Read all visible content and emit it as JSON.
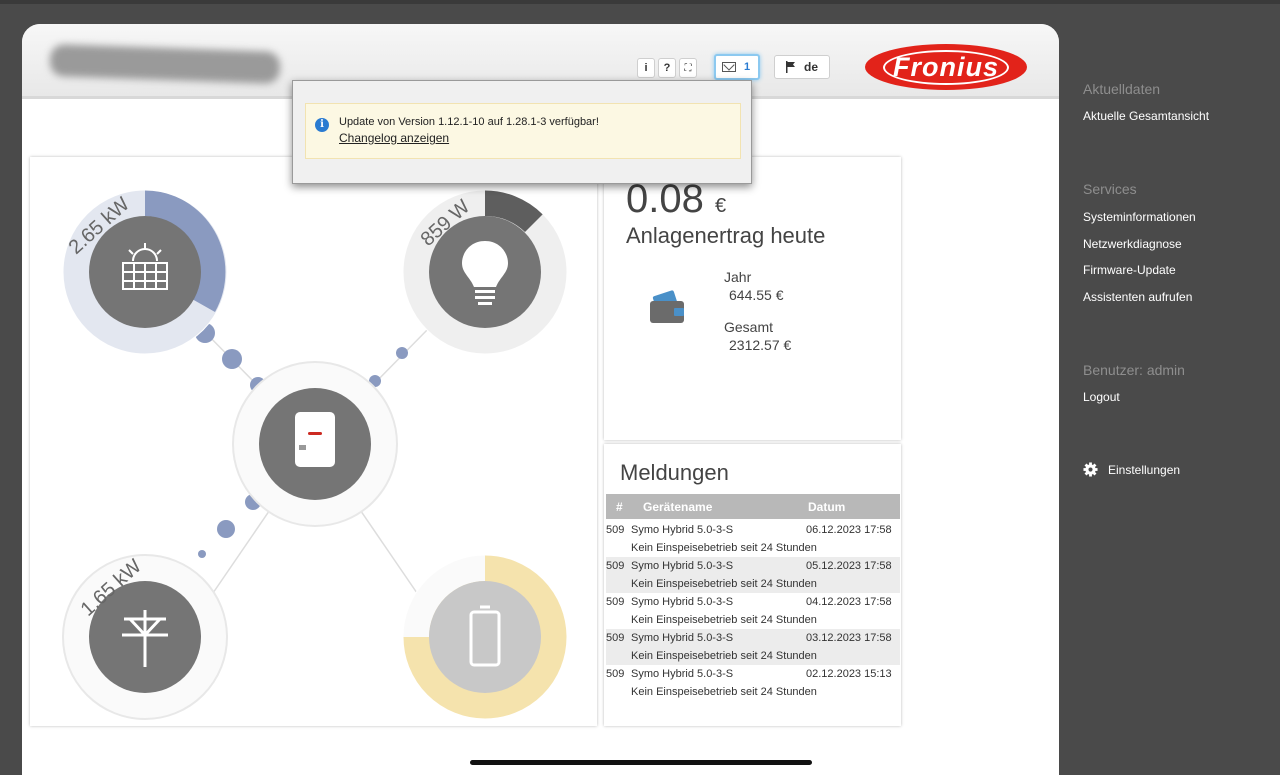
{
  "toolbar": {
    "info_label": "i",
    "help_label": "?",
    "fullscreen_label": "⛶",
    "mail_count": "1",
    "language": "de",
    "brand": "Fronius"
  },
  "popup": {
    "message": "Update von Version 1.12.1-10 auf 1.28.1-3 verfügbar!",
    "link": "Changelog anzeigen"
  },
  "flow": {
    "pv_power": "2.65 kW",
    "load_power": "859 W",
    "grid_power": "1.65 kW"
  },
  "earnings": {
    "today_value": "0.08",
    "currency": "€",
    "title": "Anlagenertrag heute",
    "year_label": "Jahr",
    "year_value": "644.55 €",
    "total_label": "Gesamt",
    "total_value": "2312.57 €"
  },
  "messages": {
    "title": "Meldungen",
    "columns": [
      "#",
      "Gerätename",
      "Datum"
    ],
    "rows": [
      {
        "num": "509",
        "device": "Symo Hybrid 5.0-3-S",
        "date": "06.12.2023 17:58",
        "text": "Kein Einspeisebetrieb seit 24 Stunden"
      },
      {
        "num": "509",
        "device": "Symo Hybrid 5.0-3-S",
        "date": "05.12.2023 17:58",
        "text": "Kein Einspeisebetrieb seit 24 Stunden"
      },
      {
        "num": "509",
        "device": "Symo Hybrid 5.0-3-S",
        "date": "04.12.2023 17:58",
        "text": "Kein Einspeisebetrieb seit 24 Stunden"
      },
      {
        "num": "509",
        "device": "Symo Hybrid 5.0-3-S",
        "date": "03.12.2023 17:58",
        "text": "Kein Einspeisebetrieb seit 24 Stunden"
      },
      {
        "num": "509",
        "device": "Symo Hybrid 5.0-3-S",
        "date": "02.12.2023 15:13",
        "text": "Kein Einspeisebetrieb seit 24 Stunden"
      }
    ]
  },
  "sidebar": {
    "section_current": "Aktuelldaten",
    "item_overview": "Aktuelle Gesamtansicht",
    "section_services": "Services",
    "item_sysinfo": "Systeminformationen",
    "item_netdiag": "Netzwerkdiagnose",
    "item_firmware": "Firmware-Update",
    "item_assist": "Assistenten aufrufen",
    "section_user": "Benutzer: admin",
    "item_logout": "Logout",
    "item_settings": "Einstellungen"
  },
  "colors": {
    "brand_red": "#e2231a",
    "pv_blue": "#8a9ac0",
    "battery_yellow": "#f5e3ad",
    "sidebar_bg": "#4a4a4a"
  }
}
